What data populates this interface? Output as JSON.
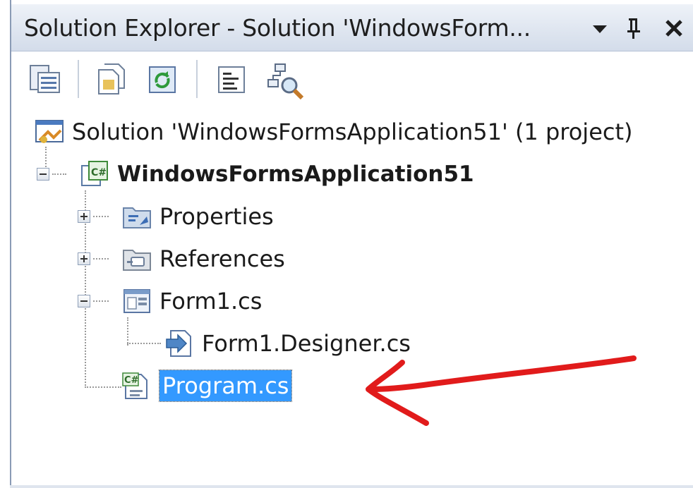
{
  "window": {
    "title": "Solution Explorer - Solution 'WindowsForm...",
    "pin_glyph": "ᅳ",
    "close_glyph": "✕"
  },
  "toolbar": {
    "buttons": [
      {
        "name": "properties-icon"
      },
      {
        "name": "show-all-files-icon"
      },
      {
        "name": "refresh-icon"
      },
      {
        "name": "view-code-icon"
      },
      {
        "name": "class-view-icon"
      }
    ]
  },
  "tree": {
    "solution": {
      "label": "Solution 'WindowsFormsApplication51' (1 project)",
      "icon": "solution-icon"
    },
    "project": {
      "label": "WindowsFormsApplication51",
      "icon": "csharp-project-icon",
      "expanded": true
    },
    "items": [
      {
        "label": "Properties",
        "icon": "properties-folder-icon",
        "expandable": true,
        "expanded": false
      },
      {
        "label": "References",
        "icon": "references-folder-icon",
        "expandable": true,
        "expanded": false
      },
      {
        "label": "Form1.cs",
        "icon": "form-icon",
        "expandable": true,
        "expanded": true
      },
      {
        "label": "Form1.Designer.cs",
        "icon": "designer-file-icon",
        "expandable": false
      },
      {
        "label": "Program.cs",
        "icon": "csharp-file-icon",
        "expandable": false,
        "selected": true
      }
    ]
  },
  "colors": {
    "selection": "#3399ff",
    "annotation_arrow": "#e11b1b",
    "titlebar": "#d3dcea"
  }
}
